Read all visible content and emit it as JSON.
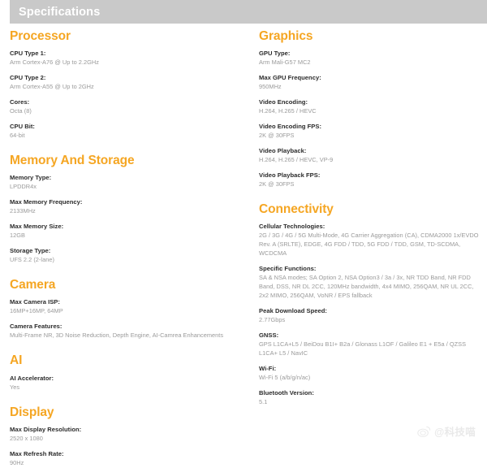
{
  "header": {
    "title": "Specifications"
  },
  "left_column": [
    {
      "title": "Processor",
      "specs": [
        {
          "label": "CPU Type 1:",
          "value": "Arm Cortex-A76 @ Up to 2.2GHz"
        },
        {
          "label": "CPU Type 2:",
          "value": "Arm Cortex-A55 @ Up to 2GHz"
        },
        {
          "label": "Cores:",
          "value": "Octa (8)"
        },
        {
          "label": "CPU Bit:",
          "value": "64-bit"
        }
      ]
    },
    {
      "title": "Memory And Storage",
      "specs": [
        {
          "label": "Memory Type:",
          "value": "LPDDR4x"
        },
        {
          "label": "Max Memory Frequency:",
          "value": "2133MHz"
        },
        {
          "label": "Max Memory Size:",
          "value": "12GB"
        },
        {
          "label": "Storage Type:",
          "value": "UFS 2.2 (2-lane)"
        }
      ]
    },
    {
      "title": "Camera",
      "specs": [
        {
          "label": "Max Camera ISP:",
          "value": "16MP+16MP,  64MP"
        },
        {
          "label": "Camera Features:",
          "value": "Multi-Frame NR, 3D Noise Reduction, Depth Engine, AI-Camrea Enhancements"
        }
      ]
    },
    {
      "title": "AI",
      "specs": [
        {
          "label": "AI Accelerator:",
          "value": "Yes"
        }
      ]
    },
    {
      "title": "Display",
      "specs": [
        {
          "label": "Max Display Resolution:",
          "value": "2520 x 1080"
        },
        {
          "label": "Max Refresh Rate:",
          "value": "90Hz"
        }
      ]
    }
  ],
  "right_column": [
    {
      "title": "Graphics",
      "specs": [
        {
          "label": "GPU Type:",
          "value": "Arm Mali-G57 MC2"
        },
        {
          "label": "Max GPU Frequency:",
          "value": "950MHz"
        },
        {
          "label": "Video Encoding:",
          "value": "H.264,  H.265 / HEVC"
        },
        {
          "label": "Video Encoding FPS:",
          "value": "2K @ 30FPS"
        },
        {
          "label": "Video Playback:",
          "value": "H.264,  H.265 / HEVC,  VP-9"
        },
        {
          "label": "Video Playback FPS:",
          "value": "2K @ 30FPS"
        }
      ]
    },
    {
      "title": "Connectivity",
      "specs": [
        {
          "label": "Cellular Technologies:",
          "value": "2G / 3G / 4G / 5G Multi-Mode,  4G Carrier Aggregation (CA),  CDMA2000 1x/EVDO Rev. A (SRLTE),  EDGE,  4G FDD / TDD,  5G FDD / TDD,  GSM,  TD-SCDMA, WCDCMA"
        },
        {
          "label": "Specific Functions:",
          "value": "SA & NSA modes; SA Option 2, NSA Option3 / 3a / 3x, NR TDD Band, NR FDD Band, DSS, NR DL 2CC, 120MHz bandwidth, 4x4 MIMO, 256QAM, NR UL 2CC, 2x2 MIMO, 256QAM, VoNR / EPS fallback"
        },
        {
          "label": "Peak Download Speed:",
          "value": "2.77Gbps"
        },
        {
          "label": "GNSS:",
          "value": "GPS L1CA+L5 / BeiDou B1I+ B2a / Glonass L1OF / Galileo E1 + E5a / QZSS L1CA+ L5 / NavIC"
        },
        {
          "label": "Wi-Fi:",
          "value": "Wi-Fi 5 (a/b/g/n/ac)"
        },
        {
          "label": "Bluetooth Version:",
          "value": "5.1"
        }
      ]
    }
  ],
  "watermark": {
    "text": "@科技喵",
    "logo_icon": "weibo-icon"
  },
  "colors": {
    "section_title": "#f5a623",
    "header_bar": "#c9c9c9",
    "label": "#2b2b2b",
    "value": "#9a9a9a"
  }
}
